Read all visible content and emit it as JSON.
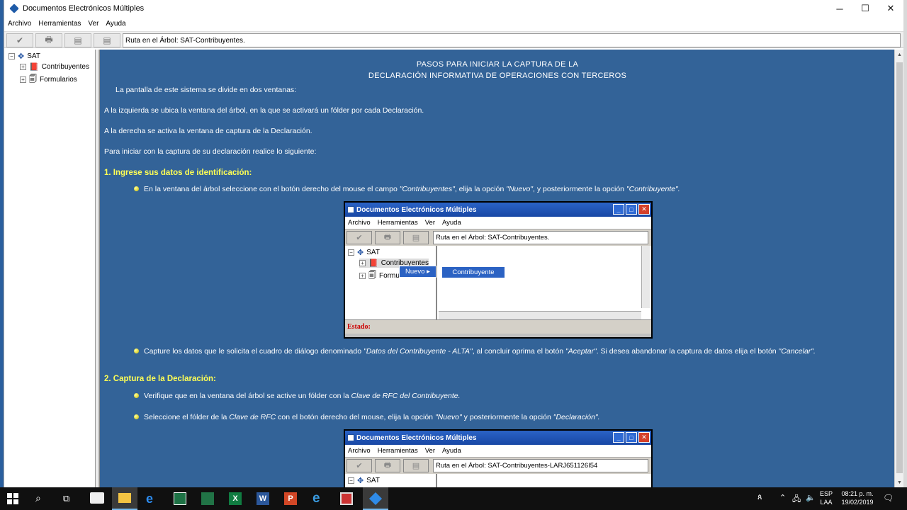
{
  "window": {
    "title": "Documentos Electrónicos Múltiples",
    "controls": {
      "minimize": "─",
      "maximize": "☐",
      "close": "✕"
    }
  },
  "menu": [
    "Archivo",
    "Herramientas",
    "Ver",
    "Ayuda"
  ],
  "toolbar": {
    "buttons": [
      "✔",
      "🖶",
      "▤",
      "▤"
    ],
    "route": "Ruta en el Árbol: SAT-Contribuyentes."
  },
  "tree": {
    "root": "SAT",
    "children": [
      "Contribuyentes",
      "Formularios"
    ],
    "expander_minus": "−",
    "expander_plus": "+"
  },
  "content": {
    "heading_line1": "PASOS PARA INICIAR LA CAPTURA DE LA",
    "heading_line2": "DECLARACIÓN INFORMATIVA DE OPERACIONES CON TERCEROS",
    "intro1": "La pantalla de este sistema se divide en dos ventanas:",
    "intro2": "A la izquierda se ubica la ventana del árbol, en la que se activará un fólder por cada Declaración.",
    "intro3": "A la derecha se activa la ventana de captura de la Declaración.",
    "intro4": "Para iniciar con la captura de su declaración realice lo siguiente:",
    "section1": "1. Ingrese sus datos de identificación:",
    "s1_b1_a": "En la ventana del árbol seleccione con el botón derecho del mouse el campo ",
    "s1_b1_b": "\"Contribuyentes\"",
    "s1_b1_c": ", elija la opción ",
    "s1_b1_d": "\"Nuevo\"",
    "s1_b1_e": ", y posteriormente la opción ",
    "s1_b1_f": "\"Contribuyente\".",
    "s1_b2_a": "Capture los datos que le solicita el cuadro de diálogo denominado ",
    "s1_b2_b": "\"Datos del Contribuyente - ALTA\"",
    "s1_b2_c": ", al concluir oprima el botón ",
    "s1_b2_d": "\"Aceptar\"",
    "s1_b2_e": ". Si desea abandonar la captura de datos elija el botón ",
    "s1_b2_f": "\"Cancelar\".",
    "section2": "2. Captura de la Declaración:",
    "s2_b1_a": "Verifique que en la ventana del árbol se active un fólder con la ",
    "s2_b1_b": "Clave de RFC del Contribuyente.",
    "s2_b2_a": "Seleccione el fólder de la ",
    "s2_b2_b": "Clave de RFC",
    "s2_b2_c": " con el botón derecho del mouse, elija la opción ",
    "s2_b2_d": "\"Nuevo\"",
    "s2_b2_e": " y posteriormente la opción ",
    "s2_b2_f": "\"Declaración\"."
  },
  "screenshot1": {
    "title": "Documentos Electrónicos Múltiples",
    "menu": [
      "Archivo",
      "Herramientas",
      "Ver",
      "Ayuda"
    ],
    "route": "Ruta en el Árbol: SAT-Contribuyentes.",
    "tree_root": "SAT",
    "tree_child1": "Contribuyentes",
    "tree_child2": "Formu",
    "ctx_nuevo": "Nuevo",
    "ctx_arrow": "▸",
    "ctx_contribuyente": "Contribuyente",
    "status": "Estado:"
  },
  "screenshot2": {
    "title": "Documentos Electrónicos Múltiples",
    "menu": [
      "Archivo",
      "Herramientas",
      "Ver",
      "Ayuda"
    ],
    "route": "Ruta en el Árbol: SAT-Contribuyentes-LARJ651126I54",
    "tree_root": "SAT"
  },
  "taskbar": {
    "lang_top": "ESP",
    "lang_bottom": "LAA",
    "time": "08:21 p. m.",
    "date": "19/02/2019"
  },
  "colors": {
    "content_bg": "#336398",
    "section_title": "#ffff55",
    "taskbar": "#101010"
  }
}
